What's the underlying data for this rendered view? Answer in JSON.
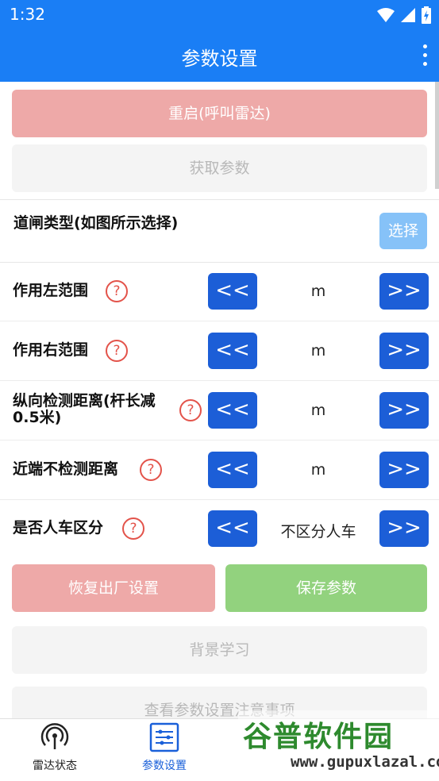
{
  "status_bar": {
    "time": "1:32"
  },
  "app_bar": {
    "title": "参数设置"
  },
  "buttons": {
    "reset": "重启(呼叫雷达)",
    "get_params": "获取参数",
    "factory_reset": "恢复出厂设置",
    "save_params": "保存参数",
    "background_learning": "背景学习",
    "view_notes": "查看参数设置注意事项"
  },
  "gate_type": {
    "label": "道闸类型(如图所示选择)",
    "button": "选择"
  },
  "params": [
    {
      "label": "作用左范围",
      "value": "m",
      "dec": "<<",
      "inc": ">>"
    },
    {
      "label": "作用右范围",
      "value": "m",
      "dec": "<<",
      "inc": ">>"
    },
    {
      "label": "纵向检测距离(杆长减0.5米)",
      "value": "m",
      "dec": "<<",
      "inc": ">>"
    },
    {
      "label": "近端不检测距离",
      "value": "m",
      "dec": "<<",
      "inc": ">>"
    },
    {
      "label": "是否人车区分",
      "value": "不区分人车",
      "dec": "<<",
      "inc": ">>"
    }
  ],
  "help_glyph": "?",
  "bottom_nav": [
    {
      "label": "雷达状态",
      "icon": "radar-icon"
    },
    {
      "label": "参数设置",
      "icon": "settings-sliders-icon",
      "active": true
    }
  ],
  "watermark": {
    "text": "谷普软件园",
    "url": "www.gupuxlazal.com"
  },
  "colors": {
    "primary": "#1a7ef5",
    "arrow_button": "#1c5ed7",
    "danger_light": "#eea9a8",
    "success_light": "#92d27e",
    "help_icon": "#e3534a"
  }
}
